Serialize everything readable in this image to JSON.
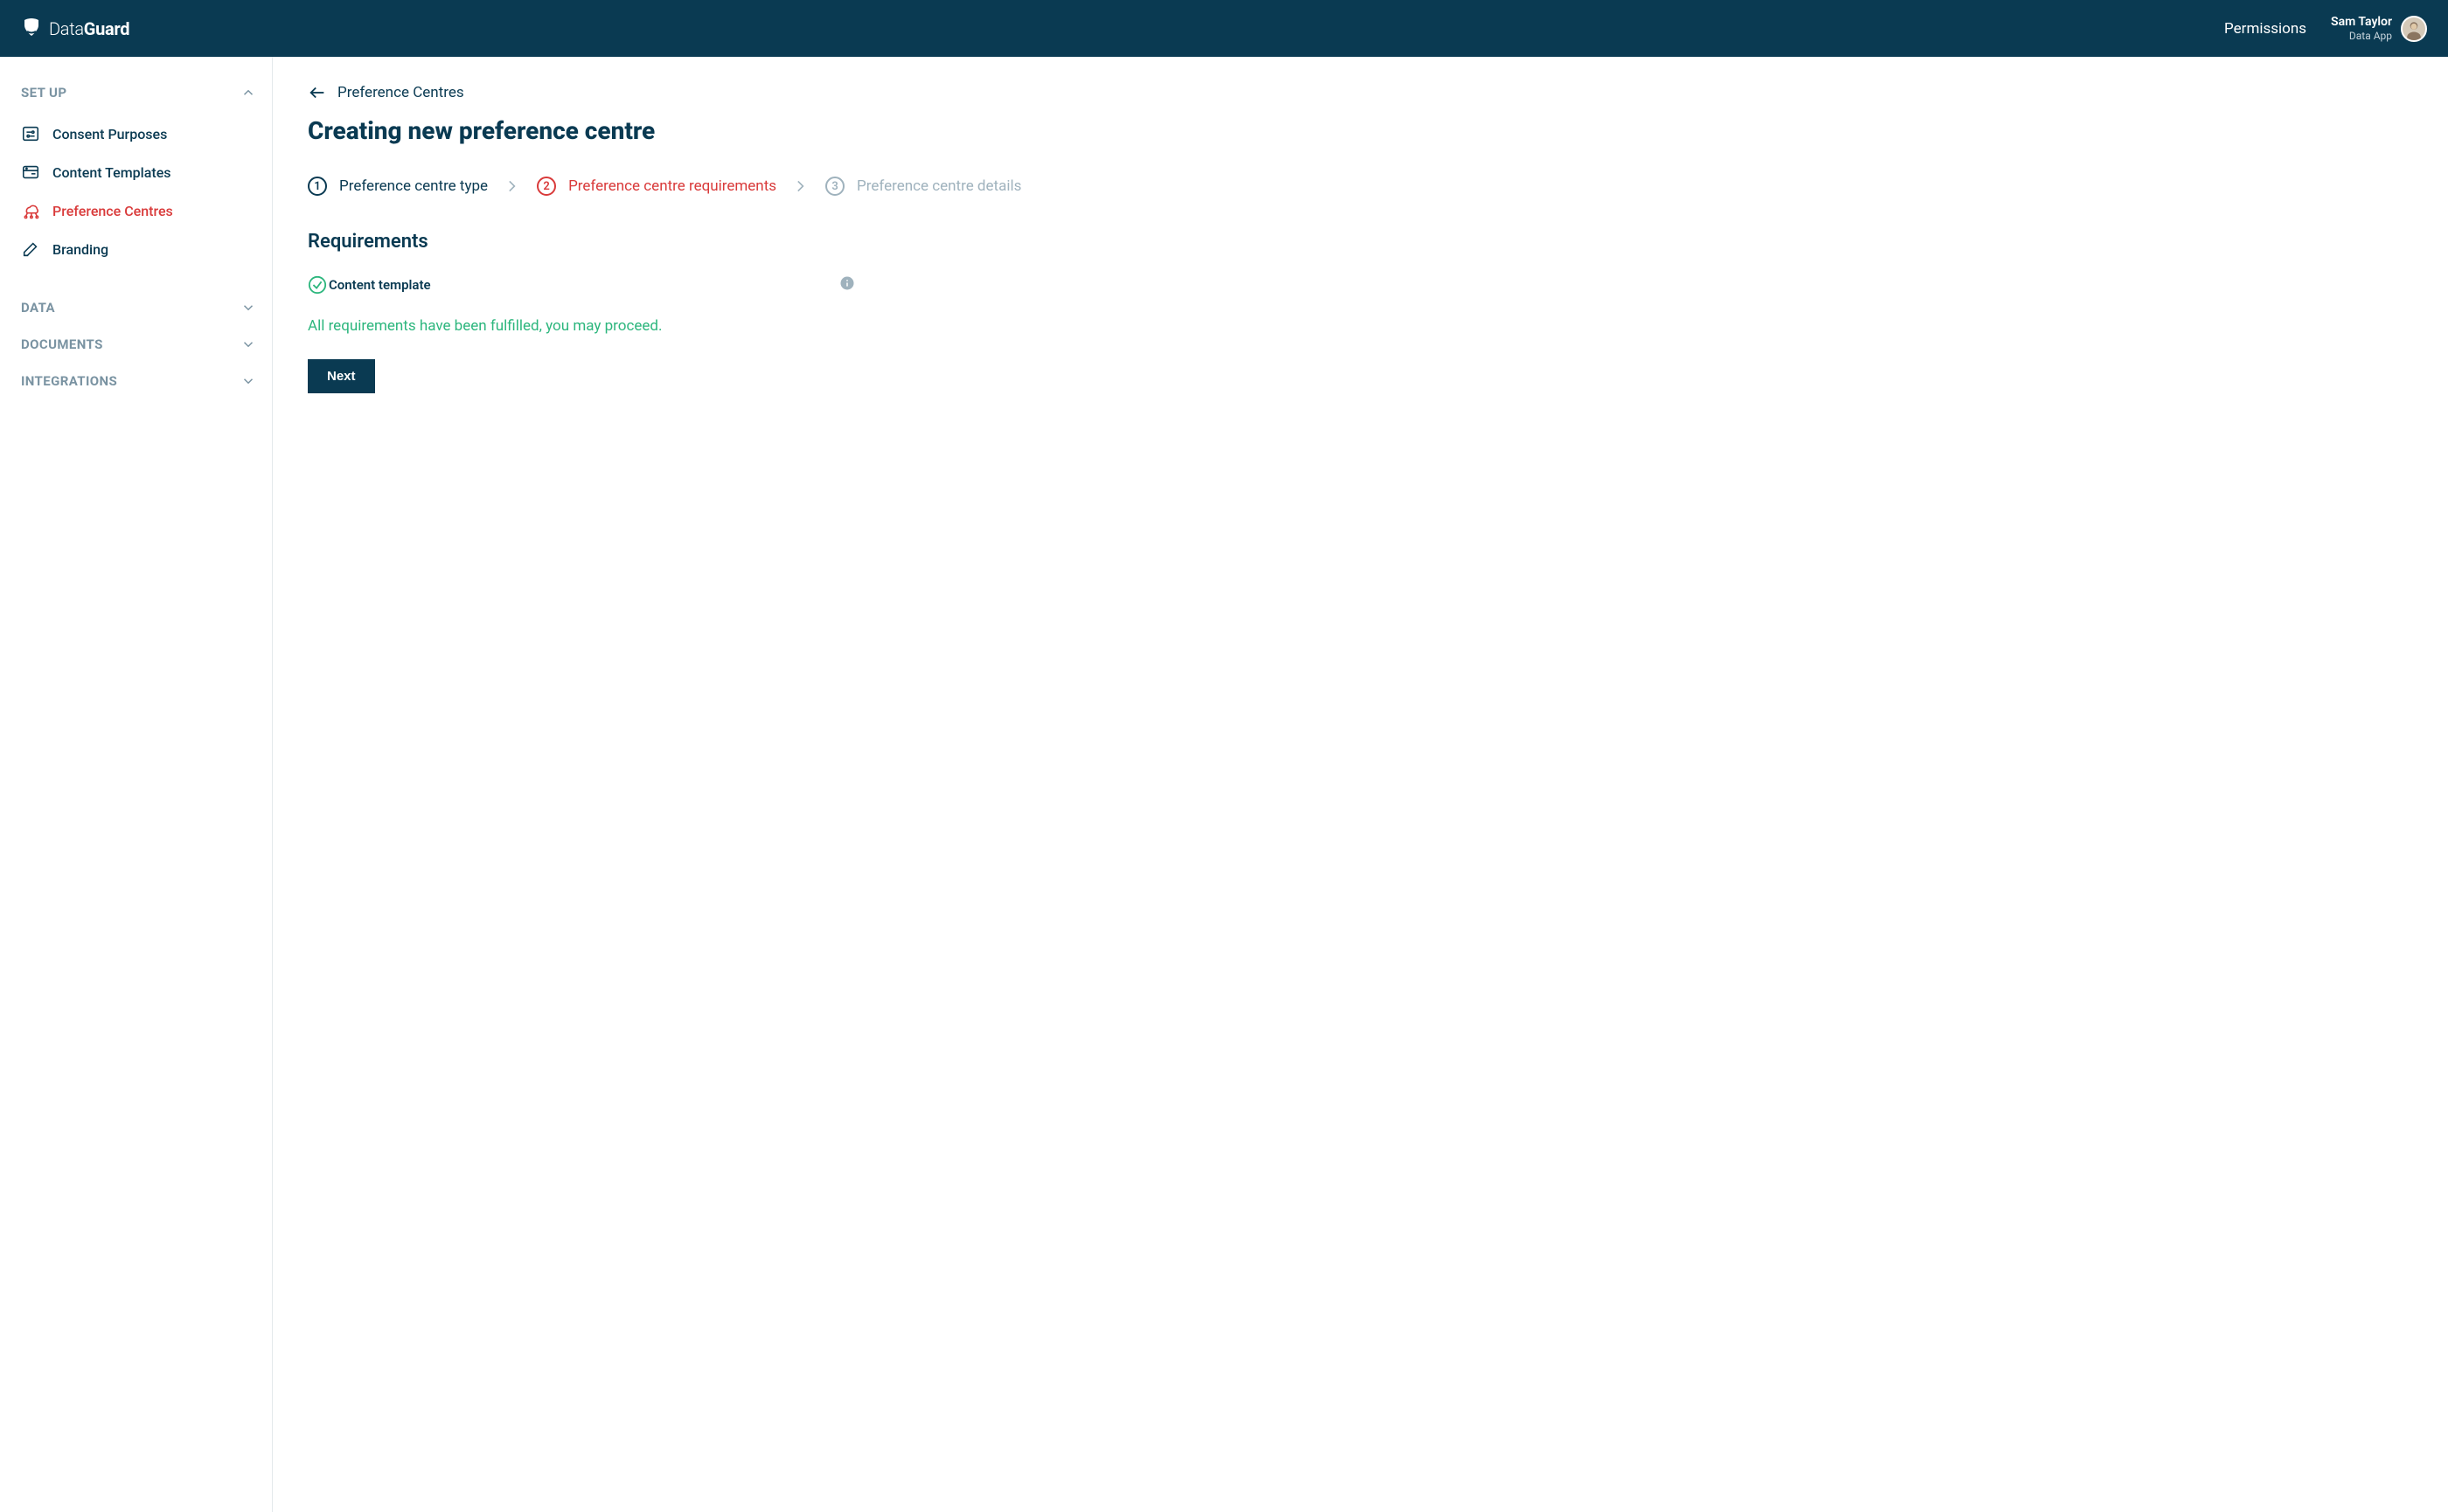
{
  "header": {
    "logo_prefix": "Data",
    "logo_suffix": "Guard",
    "permissions_label": "Permissions",
    "user": {
      "name": "Sam Taylor",
      "app": "Data App"
    }
  },
  "sidebar": {
    "sections": {
      "setup": {
        "title": "SET UP",
        "items": [
          {
            "label": "Consent Purposes"
          },
          {
            "label": "Content Templates"
          },
          {
            "label": "Preference Centres"
          },
          {
            "label": "Branding"
          }
        ]
      },
      "data": {
        "title": "DATA"
      },
      "documents": {
        "title": "DOCUMENTS"
      },
      "integrations": {
        "title": "INTEGRATIONS"
      }
    }
  },
  "breadcrumb": {
    "label": "Preference Centres"
  },
  "page": {
    "title": "Creating new preference centre"
  },
  "stepper": {
    "steps": [
      {
        "num": "1",
        "label": "Preference centre type"
      },
      {
        "num": "2",
        "label": "Preference centre requirements"
      },
      {
        "num": "3",
        "label": "Preference centre details"
      }
    ]
  },
  "requirements": {
    "heading": "Requirements",
    "items": [
      {
        "label": "Content template"
      }
    ],
    "success_message": "All requirements have been fulfilled, you may proceed.",
    "next_button": "Next"
  }
}
